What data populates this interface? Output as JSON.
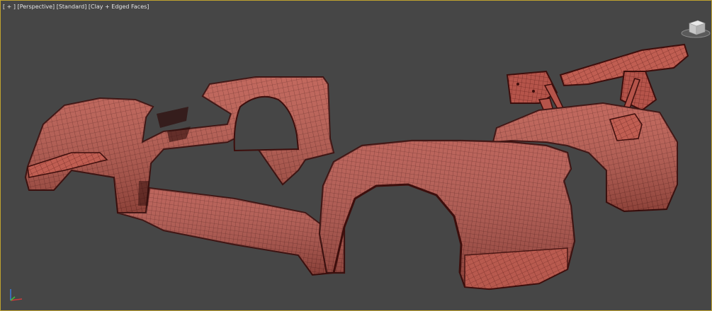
{
  "viewport": {
    "label_parts": [
      "[",
      "+",
      "]",
      " [",
      "Perspective",
      "]",
      " [",
      "Standard",
      "]",
      " [",
      "Clay + Edged Faces",
      "]"
    ],
    "menus": {
      "plus": "+",
      "view": "Perspective",
      "standard": "Standard",
      "shading": "Clay + Edged Faces"
    },
    "active_border_color": "#bfa32f",
    "background_color": "#464646"
  },
  "model": {
    "clay_color": "#b8564a",
    "edge_color": "#4a1212",
    "parts": [
      "left-side-skirt-and-fenders",
      "front-right-fender",
      "rear-wing",
      "rear-right-quarter-panel"
    ]
  },
  "icons": {
    "viewcube": "viewcube-icon",
    "axis": "axis-tripod-icon"
  },
  "axis_colors": {
    "x": "#d03a3a",
    "y": "#3ac03a",
    "z": "#3a7ad8"
  }
}
